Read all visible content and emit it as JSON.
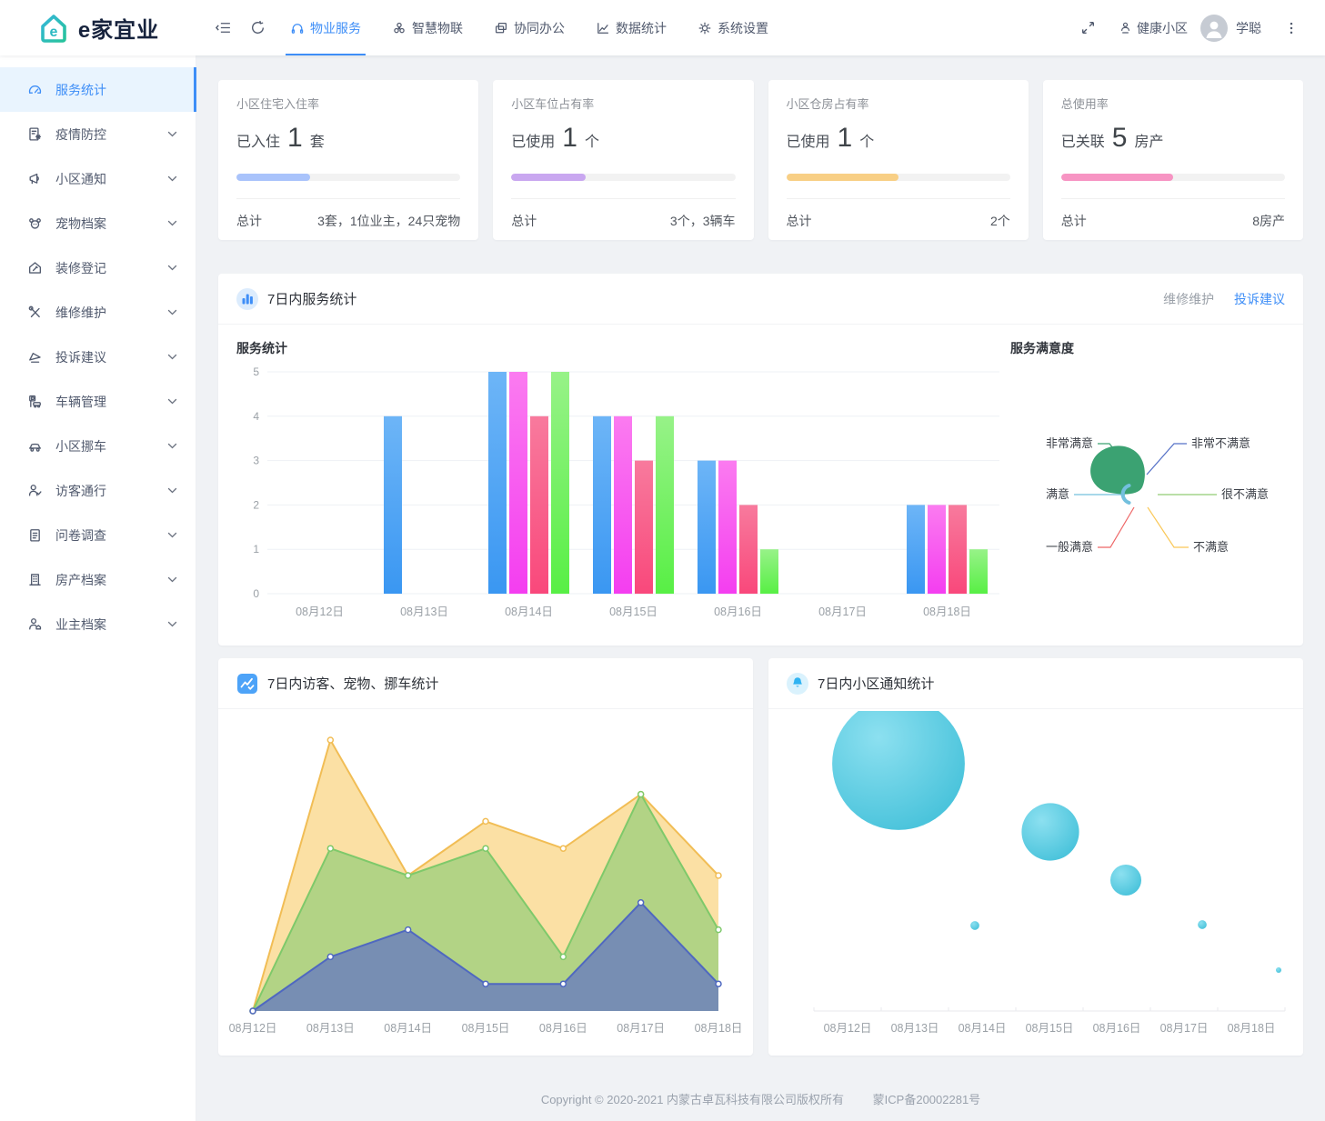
{
  "brand": {
    "name": "e家宜业"
  },
  "navbar": {
    "tabs": [
      {
        "label": "物业服务",
        "icon": "headset-icon",
        "active": true
      },
      {
        "label": "智慧物联",
        "icon": "fan-icon",
        "active": false
      },
      {
        "label": "协同办公",
        "icon": "windows-icon",
        "active": false
      },
      {
        "label": "数据统计",
        "icon": "linechart-icon",
        "active": false
      },
      {
        "label": "系统设置",
        "icon": "gear-icon",
        "active": false
      }
    ],
    "community": "健康小区",
    "username": "学聪",
    "accent": "#3e8ef7"
  },
  "sidebar": {
    "items": [
      {
        "label": "服务统计",
        "icon": "gauge-icon",
        "active": true,
        "expandable": false
      },
      {
        "label": "疫情防控",
        "icon": "epidemic-icon",
        "active": false,
        "expandable": true
      },
      {
        "label": "小区通知",
        "icon": "megaphone-icon",
        "active": false,
        "expandable": true
      },
      {
        "label": "宠物档案",
        "icon": "pet-icon",
        "active": false,
        "expandable": true
      },
      {
        "label": "装修登记",
        "icon": "renovation-icon",
        "active": false,
        "expandable": true
      },
      {
        "label": "维修维护",
        "icon": "tools-icon",
        "active": false,
        "expandable": true
      },
      {
        "label": "投诉建议",
        "icon": "complaint-icon",
        "active": false,
        "expandable": true
      },
      {
        "label": "车辆管理",
        "icon": "parking-icon",
        "active": false,
        "expandable": true
      },
      {
        "label": "小区挪车",
        "icon": "car-icon",
        "active": false,
        "expandable": true
      },
      {
        "label": "访客通行",
        "icon": "visitor-icon",
        "active": false,
        "expandable": true
      },
      {
        "label": "问卷调查",
        "icon": "survey-icon",
        "active": false,
        "expandable": true
      },
      {
        "label": "房产档案",
        "icon": "building-icon",
        "active": false,
        "expandable": true
      },
      {
        "label": "业主档案",
        "icon": "owner-icon",
        "active": false,
        "expandable": true
      }
    ]
  },
  "cards": [
    {
      "title": "小区住宅入住率",
      "prefix": "已入住",
      "value": "1",
      "unit": "套",
      "percent": 33,
      "color": "#a9c3fb",
      "total_label": "总计",
      "total_value": "3套，1位业主，24只宠物"
    },
    {
      "title": "小区车位占有率",
      "prefix": "已使用",
      "value": "1",
      "unit": "个",
      "percent": 33,
      "color": "#c9a7f0",
      "total_label": "总计",
      "total_value": "3个，3辆车"
    },
    {
      "title": "小区仓房占有率",
      "prefix": "已使用",
      "value": "1",
      "unit": "个",
      "percent": 50,
      "color": "#f8cf85",
      "total_label": "总计",
      "total_value": "2个"
    },
    {
      "title": "总使用率",
      "prefix": "已关联",
      "value": "5",
      "unit": "房产",
      "percent": 50,
      "color": "#f794c3",
      "total_label": "总计",
      "total_value": "8房产"
    }
  ],
  "service_panel": {
    "title": "7日内服务统计",
    "link_repair": "维修维护",
    "link_complaint": "投诉建议",
    "bar_title": "服务统计",
    "pie_title": "服务满意度"
  },
  "visitor_panel": {
    "title": "7日内访客、宠物、挪车统计"
  },
  "notice_panel": {
    "title": "7日内小区通知统计"
  },
  "footer": {
    "copyright": "Copyright © 2020-2021 内蒙古卓瓦科技有限公司版权所有",
    "icp": "蒙ICP备20002281号"
  },
  "chart_data": [
    {
      "type": "bar",
      "title": "服务统计",
      "categories": [
        "08月12日",
        "08月13日",
        "08月14日",
        "08月15日",
        "08月16日",
        "08月17日",
        "08月18日"
      ],
      "series": [
        {
          "name": "series-blue",
          "color_top": "#6db5f7",
          "color_bottom": "#3a97f2",
          "values": [
            0,
            4,
            5,
            4,
            3,
            0,
            2
          ]
        },
        {
          "name": "series-magenta",
          "color_top": "#fb7bf0",
          "color_bottom": "#f43ef0",
          "values": [
            0,
            0,
            5,
            4,
            3,
            0,
            2
          ]
        },
        {
          "name": "series-rose",
          "color_top": "#f87a9d",
          "color_bottom": "#f9487b",
          "values": [
            0,
            0,
            4,
            3,
            2,
            0,
            2
          ]
        },
        {
          "name": "series-green",
          "color_top": "#97f288",
          "color_bottom": "#58ef45",
          "values": [
            0,
            0,
            5,
            4,
            1,
            0,
            1
          ]
        }
      ],
      "ylim": [
        0,
        5
      ],
      "yticks": [
        0,
        1,
        2,
        3,
        4,
        5
      ],
      "grid": true,
      "legend": false
    },
    {
      "type": "pie",
      "style": "rose",
      "title": "服务满意度",
      "items": [
        {
          "name": "非常满意",
          "value": 2,
          "color": "#3ba272"
        },
        {
          "name": "满意",
          "value": 1,
          "color": "#73c0de"
        },
        {
          "name": "一般满意",
          "value": 0,
          "color": "#ee6666"
        },
        {
          "name": "不满意",
          "value": 0,
          "color": "#fac858"
        },
        {
          "name": "很不满意",
          "value": 0,
          "color": "#91cc75"
        },
        {
          "name": "非常不满意",
          "value": 0,
          "color": "#5470c6"
        }
      ]
    },
    {
      "type": "area",
      "title": "7日内访客、宠物、挪车统计",
      "categories": [
        "08月12日",
        "08月13日",
        "08月14日",
        "08月15日",
        "08月16日",
        "08月17日",
        "08月18日"
      ],
      "series": [
        {
          "name": "series-amber",
          "color": "#f1bd55",
          "fill": "rgba(247,198,90,0.55)",
          "values": [
            0,
            10,
            5,
            7,
            6,
            8,
            5
          ]
        },
        {
          "name": "series-green",
          "color": "#7ec96a",
          "fill": "rgba(139,205,117,0.65)",
          "values": [
            0,
            6,
            5,
            6,
            2,
            8,
            3
          ]
        },
        {
          "name": "series-blue",
          "color": "#4f68c0",
          "fill": "rgba(94,112,198,0.70)",
          "values": [
            0,
            2,
            3,
            1,
            1,
            4,
            1
          ]
        }
      ],
      "ylim": [
        0,
        10
      ],
      "legend": false
    },
    {
      "type": "scatter",
      "title": "7日内小区通知统计",
      "categories": [
        "08月12日",
        "08月13日",
        "08月14日",
        "08月15日",
        "08月16日",
        "08月17日",
        "08月18日"
      ],
      "values": [
        0,
        30,
        2,
        13,
        7,
        2,
        1
      ],
      "color": "#55c9e0"
    }
  ]
}
